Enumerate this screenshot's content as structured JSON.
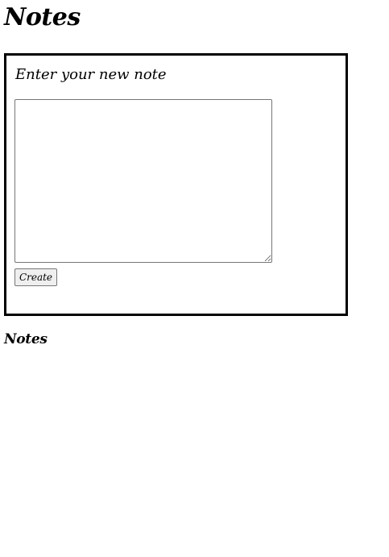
{
  "header": {
    "title": "Notes"
  },
  "form": {
    "heading": "Enter your new note",
    "textarea_value": "",
    "create_label": "Create"
  },
  "notes_section": {
    "heading": "Notes",
    "items": []
  }
}
